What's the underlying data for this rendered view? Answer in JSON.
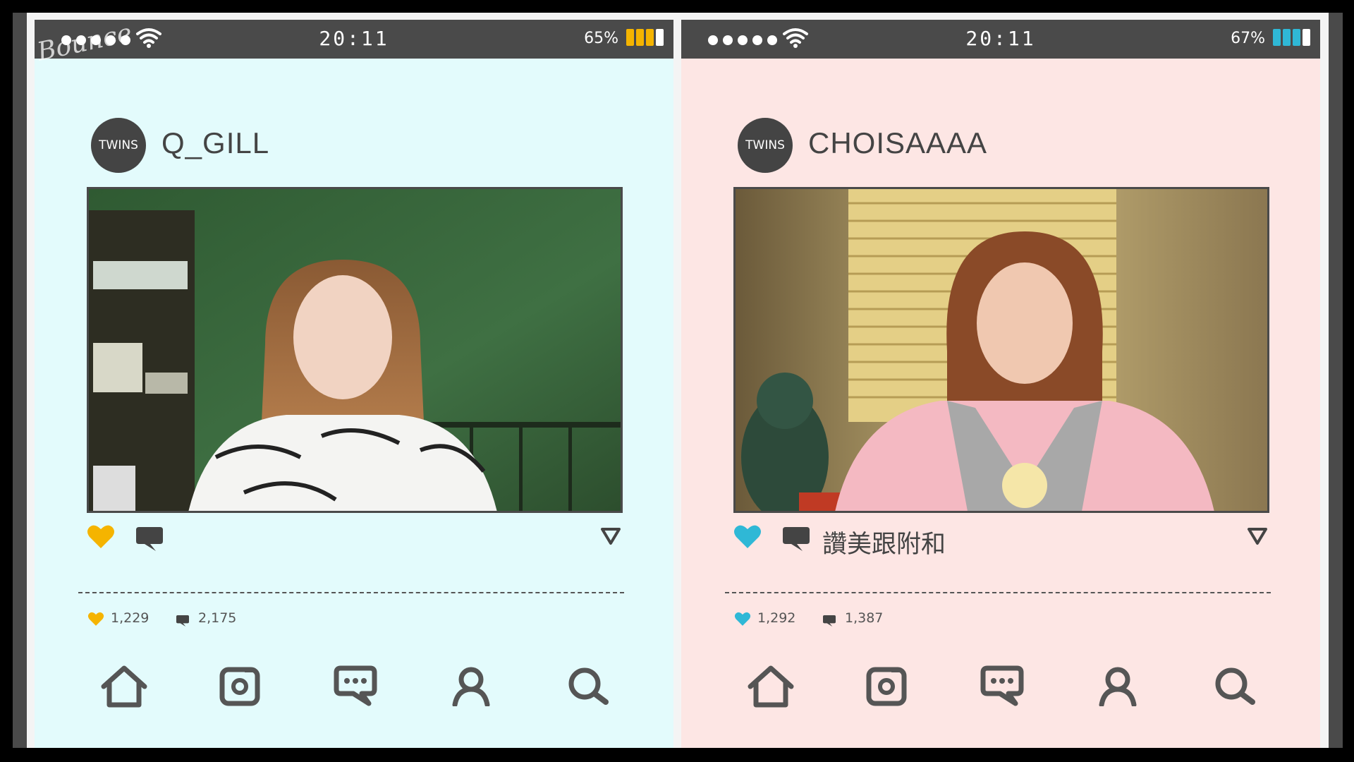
{
  "watermark": {
    "text": "Bounce"
  },
  "phones": [
    {
      "status": {
        "time": "20:11",
        "battery": "65%",
        "battery_color": "#f5b400"
      },
      "profile": {
        "avatar_text": "TWINS",
        "username": "Q_GILL"
      },
      "actions": {
        "caption": "",
        "heart_color": "#f5b400"
      },
      "stats": {
        "likes": "1,229",
        "comments": "2,175"
      },
      "theme": {
        "background": "#e3fbfc"
      }
    },
    {
      "status": {
        "time": "20:11",
        "battery": "67%",
        "battery_color": "#2fb8d6"
      },
      "profile": {
        "avatar_text": "TWINS",
        "username": "CHOISAAAA"
      },
      "actions": {
        "caption": "讚美跟附和",
        "heart_color": "#2fb8d6"
      },
      "stats": {
        "likes": "1,292",
        "comments": "1,387"
      },
      "theme": {
        "background": "#fde6e4"
      }
    }
  ],
  "icons": {
    "nav": [
      "home-icon",
      "camera-icon",
      "chat-icon",
      "profile-icon",
      "search-icon"
    ],
    "actions": [
      "heart-icon",
      "comment-icon",
      "menu-arrow-icon"
    ]
  }
}
